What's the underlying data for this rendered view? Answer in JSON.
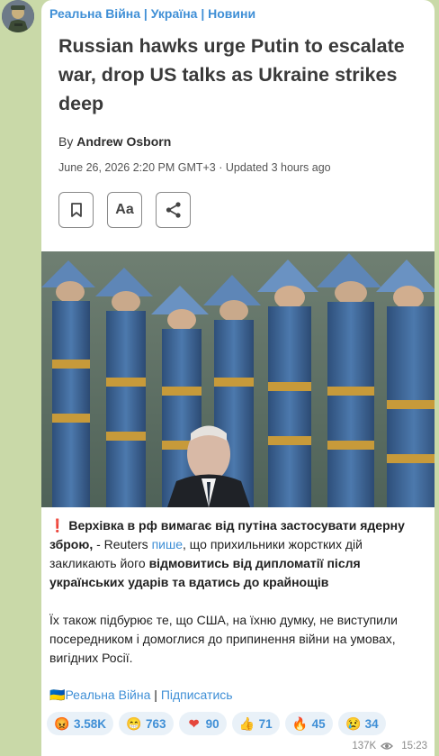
{
  "channel": {
    "name": "Реальна Війна | Україна | Новини"
  },
  "article": {
    "headline": "Russian hawks urge Putin to escalate war, drop US talks as Ukraine strikes deep",
    "by_prefix": "By",
    "author": "Andrew Osborn",
    "dateline": "June 26, 2026 2:20 PM GMT+3 · Updated 3 hours ago",
    "toolbar": {
      "font_label": "Aa",
      "bookmark_icon": "bookmark-icon",
      "share_icon": "share-icon"
    }
  },
  "post": {
    "p1_emoji": "❗",
    "p1_bold_1": "Верхівка в рф вимагає від путіна застосувати ядерну зброю,",
    "p1_text_1": " - Reuters ",
    "p1_link": "пише",
    "p1_text_2": ", що прихильники жорстких дій закликають його ",
    "p1_bold_2": "відмовитись від дипломатії після українських ударів та вдатись до крайнощів",
    "p2": "Їх також підбурює те, що США, на їхню думку, не виступили посередником і домоглися до припинення війни на умовах, вигідних Росії.",
    "footer_flag": "🇺🇦",
    "footer_channel": "Реальна Війна",
    "footer_sep": " | ",
    "footer_subscribe": "Підписатись"
  },
  "reactions": [
    {
      "emoji": "😡",
      "count": "3.58K",
      "color": "#e5463c"
    },
    {
      "emoji": "😁",
      "count": "763",
      "color": "#f2b636"
    },
    {
      "emoji": "❤",
      "count": "90",
      "color": "#e5463c"
    },
    {
      "emoji": "👍",
      "count": "71",
      "color": "#f2b636"
    },
    {
      "emoji": "🔥",
      "count": "45",
      "color": "#f07a2a"
    },
    {
      "emoji": "😢",
      "count": "34",
      "color": "#f2b636"
    }
  ],
  "meta": {
    "views": "137K",
    "time": "15:23"
  }
}
